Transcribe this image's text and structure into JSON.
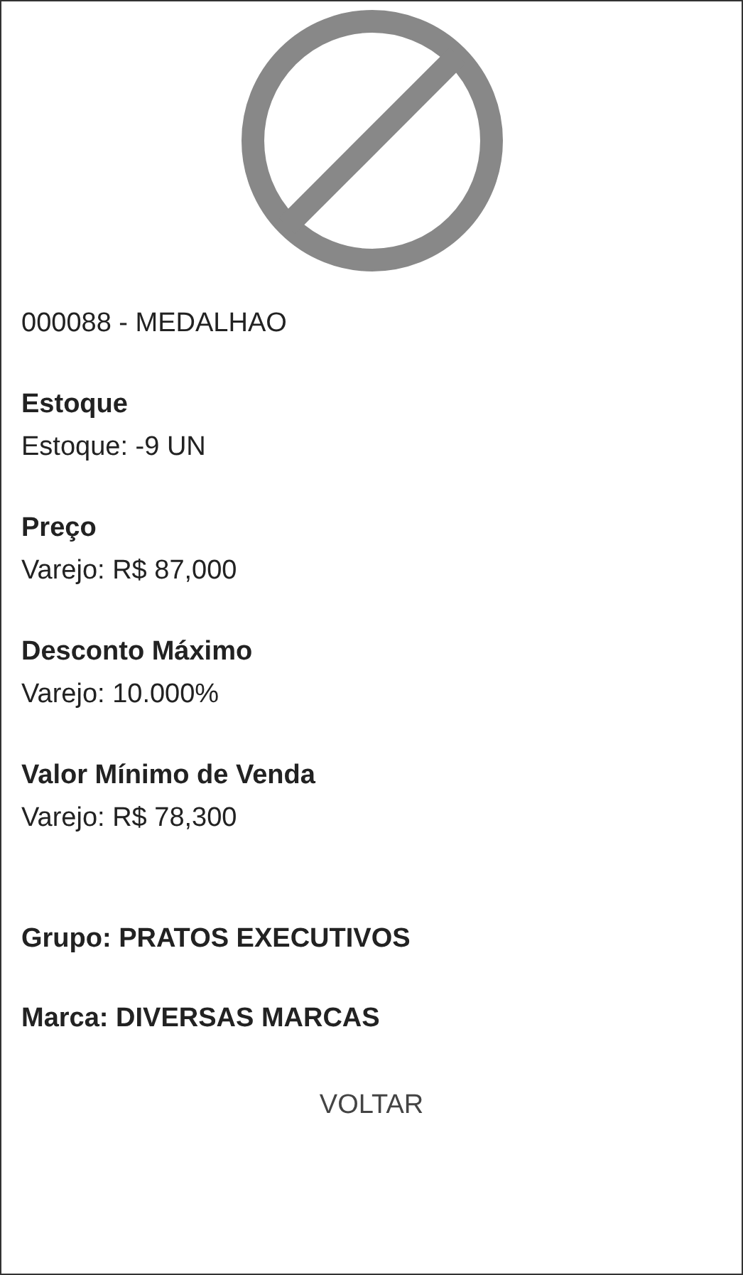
{
  "product_title": "000088 - MEDALHAO",
  "sections": [
    {
      "heading": "Estoque",
      "value": "Estoque: -9 UN"
    },
    {
      "heading": "Preço",
      "value": "Varejo: R$ 87,000"
    },
    {
      "heading": "Desconto Máximo",
      "value": "Varejo: 10.000%"
    },
    {
      "heading": "Valor Mínimo de Venda",
      "value": "Varejo: R$ 78,300"
    }
  ],
  "group": "Grupo: PRATOS EXECUTIVOS",
  "brand": "Marca: DIVERSAS MARCAS",
  "back_button": "VOLTAR"
}
